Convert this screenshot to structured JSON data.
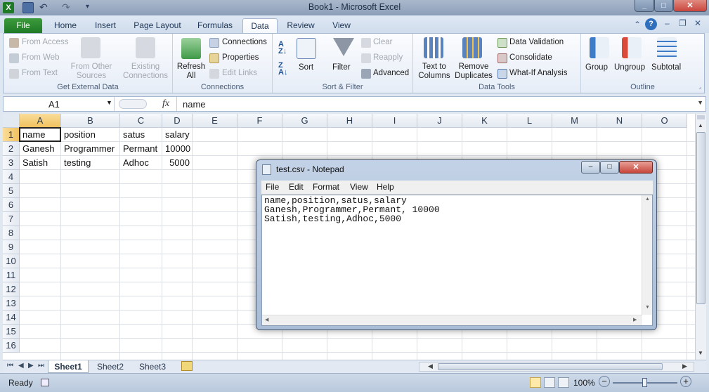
{
  "window": {
    "title": "Book1  -  Microsoft Excel"
  },
  "tabs": [
    "File",
    "Home",
    "Insert",
    "Page Layout",
    "Formulas",
    "Data",
    "Review",
    "View"
  ],
  "active_tab": "Data",
  "ribbon": {
    "get_external": {
      "label": "Get External Data",
      "from_access": "From Access",
      "from_web": "From Web",
      "from_text": "From Text",
      "from_other_1": "From Other",
      "from_other_2": "Sources",
      "existing_1": "Existing",
      "existing_2": "Connections"
    },
    "connections": {
      "label": "Connections",
      "refresh_1": "Refresh",
      "refresh_2": "All",
      "connections": "Connections",
      "properties": "Properties",
      "edit_links": "Edit Links"
    },
    "sort_filter": {
      "label": "Sort & Filter",
      "sort": "Sort",
      "filter": "Filter",
      "clear": "Clear",
      "reapply": "Reapply",
      "advanced": "Advanced"
    },
    "data_tools": {
      "label": "Data Tools",
      "ttc_1": "Text to",
      "ttc_2": "Columns",
      "rd_1": "Remove",
      "rd_2": "Duplicates",
      "validation": "Data Validation",
      "consolidate": "Consolidate",
      "whatif": "What-If Analysis"
    },
    "outline": {
      "label": "Outline",
      "group": "Group",
      "ungroup": "Ungroup",
      "subtotal": "Subtotal"
    }
  },
  "formula_bar": {
    "name_box": "A1",
    "fx": "fx",
    "content": "name"
  },
  "columns": [
    "A",
    "B",
    "C",
    "D",
    "E",
    "F",
    "G",
    "H",
    "I",
    "J",
    "K",
    "L",
    "M",
    "N",
    "O"
  ],
  "rows": [
    "1",
    "2",
    "3",
    "4",
    "5",
    "6",
    "7",
    "8",
    "9",
    "10",
    "11",
    "12",
    "13",
    "14",
    "15",
    "16"
  ],
  "cells": {
    "A1": "name",
    "B1": "position",
    "C1": "satus",
    "D1": "salary",
    "A2": "Ganesh",
    "B2": "Programmer",
    "C2": "Permant",
    "D2": "10000",
    "A3": "Satish",
    "B3": "testing",
    "C3": "Adhoc",
    "D3": "5000"
  },
  "sheets": [
    "Sheet1",
    "Sheet2",
    "Sheet3"
  ],
  "active_sheet": "Sheet1",
  "status": {
    "ready": "Ready",
    "zoom": "100%"
  },
  "notepad": {
    "title": "test.csv - Notepad",
    "menu": [
      "File",
      "Edit",
      "Format",
      "View",
      "Help"
    ],
    "lines": [
      "name,position,satus,salary",
      "Ganesh,Programmer,Permant, 10000",
      "Satish,testing,Adhoc,5000"
    ]
  },
  "colors": {
    "file_tab": "#2a8a31",
    "window_close": "#c9463d",
    "accent": "#1e3555"
  }
}
